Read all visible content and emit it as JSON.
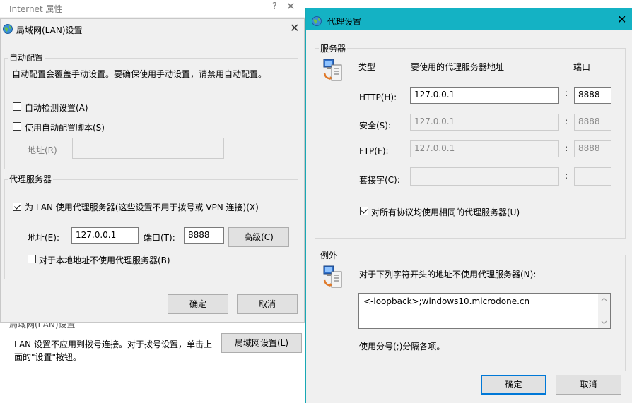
{
  "internet_props": {
    "title": "Internet 属性",
    "help": "?",
    "close": "✕",
    "lan_section_heading": "局域网(LAN)设置",
    "lan_description": "LAN 设置不应用到拨号连接。对于拨号设置，单击上面的\"设置\"按钮。",
    "lan_settings_button": "局域网设置(L)"
  },
  "lan_dialog": {
    "title": "局域网(LAN)设置",
    "close": "✕",
    "auto_config": {
      "group_title": "自动配置",
      "description": "自动配置会覆盖手动设置。要确保使用手动设置，请禁用自动配置。",
      "auto_detect_label": "自动检测设置(A)",
      "auto_script_label": "使用自动配置脚本(S)",
      "address_label": "地址(R)",
      "address_value": ""
    },
    "proxy_server": {
      "group_title": "代理服务器",
      "use_proxy_label": "为 LAN 使用代理服务器(这些设置不用于拨号或 VPN 连接)(X)",
      "address_label": "地址(E):",
      "address_value": "127.0.0.1",
      "port_label": "端口(T):",
      "port_value": "8888",
      "advanced_button": "高级(C)",
      "bypass_local_label": "对于本地地址不使用代理服务器(B)"
    },
    "ok_button": "确定",
    "cancel_button": "取消"
  },
  "proxy_dialog": {
    "title": "代理设置",
    "close": "✕",
    "servers": {
      "group_title": "服务器",
      "col_type": "类型",
      "col_address": "要使用的代理服务器地址",
      "col_port": "端口",
      "rows": [
        {
          "label": "HTTP(H):",
          "address": "127.0.0.1",
          "port": "8888"
        },
        {
          "label": "安全(S):",
          "address": "127.0.0.1",
          "port": "8888"
        },
        {
          "label": "FTP(F):",
          "address": "127.0.0.1",
          "port": "8888"
        },
        {
          "label": "套接字(C):",
          "address": "",
          "port": ""
        }
      ],
      "colon": ":",
      "same_proxy_label": "对所有协议均使用相同的代理服务器(U)"
    },
    "exceptions": {
      "group_title": "例外",
      "description": "对于下列字符开头的地址不使用代理服务器(N):",
      "value": "<-loopback>;windows10.microdone.cn",
      "hint": "使用分号(;)分隔各项。"
    },
    "ok_button": "确定",
    "cancel_button": "取消"
  }
}
